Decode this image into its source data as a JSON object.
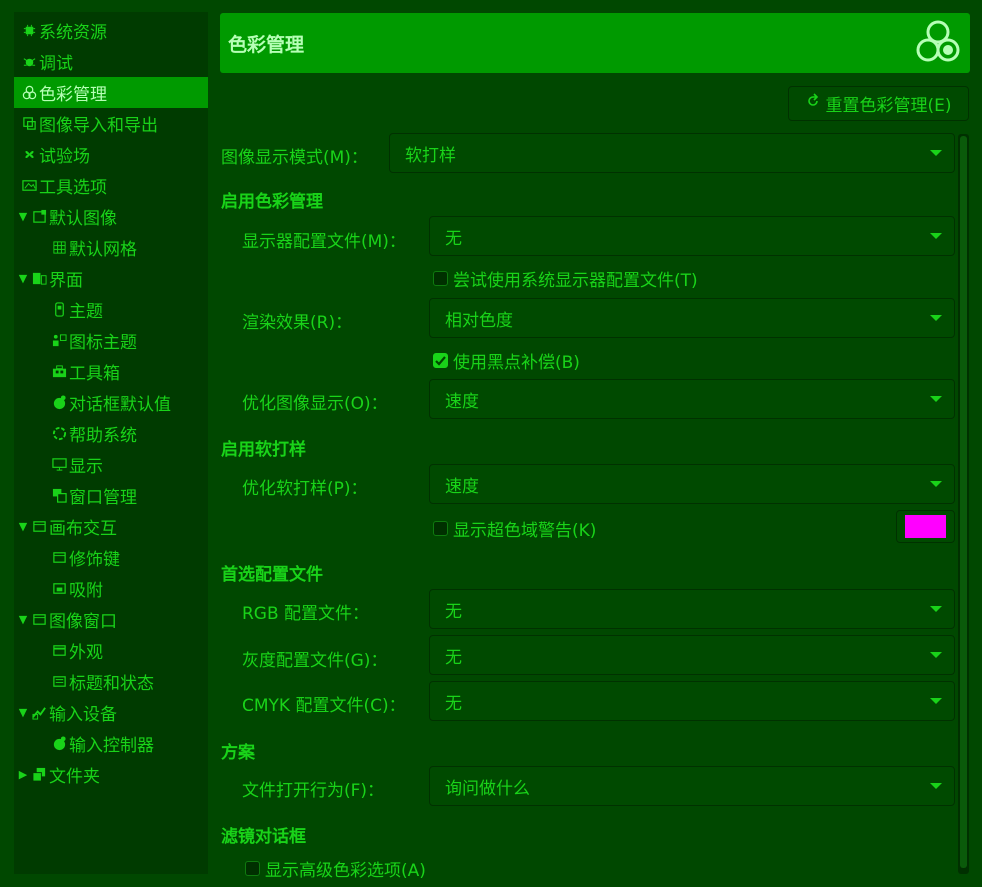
{
  "sidebar": {
    "items": [
      {
        "label": "系统资源",
        "icon": "chip-icon"
      },
      {
        "label": "调试",
        "icon": "bug-icon"
      },
      {
        "label": "色彩管理",
        "icon": "color-circles-icon"
      },
      {
        "label": "图像导入和导出",
        "icon": "import-export-icon"
      },
      {
        "label": "试验场",
        "icon": "flask-icon"
      },
      {
        "label": "工具选项",
        "icon": "tool-options-icon"
      },
      {
        "label": "默认图像",
        "icon": "default-image-icon"
      },
      {
        "label": "默认网格",
        "icon": "grid-icon"
      },
      {
        "label": "界面",
        "icon": "interface-icon"
      },
      {
        "label": "主题",
        "icon": "theme-icon"
      },
      {
        "label": "图标主题",
        "icon": "icon-theme-icon"
      },
      {
        "label": "工具箱",
        "icon": "toolbox-icon"
      },
      {
        "label": "对话框默认值",
        "icon": "dialog-defaults-icon"
      },
      {
        "label": "帮助系统",
        "icon": "help-icon"
      },
      {
        "label": "显示",
        "icon": "display-icon"
      },
      {
        "label": "窗口管理",
        "icon": "window-management-icon"
      },
      {
        "label": "画布交互",
        "icon": "canvas-icon"
      },
      {
        "label": "修饰键",
        "icon": "modifier-keys-icon"
      },
      {
        "label": "吸附",
        "icon": "snap-icon"
      },
      {
        "label": "图像窗口",
        "icon": "image-window-icon"
      },
      {
        "label": "外观",
        "icon": "appearance-icon"
      },
      {
        "label": "标题和状态",
        "icon": "title-status-icon"
      },
      {
        "label": "输入设备",
        "icon": "input-device-icon"
      },
      {
        "label": "输入控制器",
        "icon": "input-controller-icon"
      },
      {
        "label": "文件夹",
        "icon": "folder-icon"
      }
    ]
  },
  "banner": {
    "title": "色彩管理",
    "icon": "color-circles-icon"
  },
  "reset_button": {
    "label": "重置色彩管理(E)",
    "icon": "reset-icon"
  },
  "image_display_mode": {
    "label": "图像显示模式(M)：",
    "value": "软打样"
  },
  "section_color_management": "启用色彩管理",
  "monitor_profile": {
    "label": "显示器配置文件(M)：",
    "value": "无"
  },
  "try_system_monitor_profile": {
    "label": "尝试使用系统显示器配置文件(T)",
    "checked": false
  },
  "rendering_intent": {
    "label": "渲染效果(R)：",
    "value": "相对色度"
  },
  "black_point_compensation": {
    "label": "使用黑点补偿(B)",
    "checked": true
  },
  "optimize_display": {
    "label": "优化图像显示(O)：",
    "value": "速度"
  },
  "section_soft_proof": "启用软打样",
  "optimize_soft_proof": {
    "label": "优化软打样(P)：",
    "value": "速度"
  },
  "gamut_warning": {
    "label": "显示超色域警告(K)",
    "checked": false,
    "color": "#ff00ff"
  },
  "section_preferred_profiles": "首选配置文件",
  "rgb_profile": {
    "label": "RGB 配置文件：",
    "value": "无"
  },
  "gray_profile": {
    "label": "灰度配置文件(G)：",
    "value": "无"
  },
  "cmyk_profile": {
    "label": "CMYK 配置文件(C)：",
    "value": "无"
  },
  "section_policies": "方案",
  "file_open_behavior": {
    "label": "文件打开行为(F)：",
    "value": "询问做什么"
  },
  "section_filter_dialogs": "滤镜对话框",
  "show_advanced_color": {
    "label": "显示高级色彩选项(A)",
    "checked": false
  },
  "colors": {
    "background": "#004800",
    "text": "#19d319",
    "selected": "#009a00",
    "swatch": "#ff00ff"
  }
}
